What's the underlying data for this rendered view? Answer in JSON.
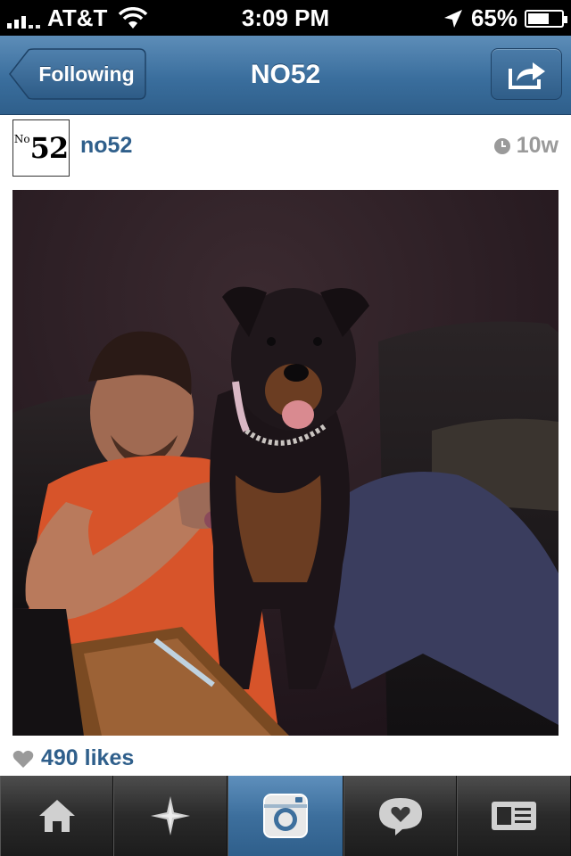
{
  "status_bar": {
    "carrier": "AT&T",
    "time": "3:09 PM",
    "battery": "65%",
    "battery_level": 0.65
  },
  "nav": {
    "back_label": "Following",
    "title": "NO52"
  },
  "post": {
    "avatar_sup": "No",
    "avatar_num": "52",
    "username": "no52",
    "time_ago": "10w",
    "likes": "490 likes"
  },
  "tabbar": {
    "items": [
      {
        "name": "home-icon",
        "active": false
      },
      {
        "name": "explore-icon",
        "active": false
      },
      {
        "name": "camera-icon",
        "active": true
      },
      {
        "name": "news-icon",
        "active": false
      },
      {
        "name": "profile-icon",
        "active": false
      }
    ]
  },
  "colors": {
    "accent": "#2f5f8b",
    "nav": "#3a6e9d",
    "muted": "#9a9a9a"
  }
}
